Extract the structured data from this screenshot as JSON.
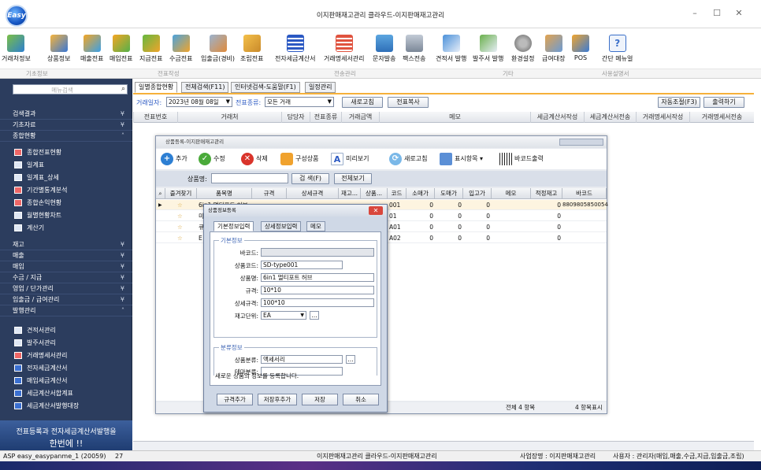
{
  "window": {
    "title": "이지판매재고관리 클라우드-이지판매재고관리",
    "logo_text": "Easy"
  },
  "ribbon": {
    "items": [
      "거래처정보",
      "상품정보",
      "매출전표",
      "매입전표",
      "지급전표",
      "수금전표",
      "입출금(경비)",
      "조립전표",
      "전자세금계산서",
      "거래명세서관리",
      "문자발송",
      "팩스전송",
      "견적서 발행",
      "발주서 발행",
      "환경설정",
      "급여대장",
      "POS",
      "간단 메뉴얼"
    ],
    "groups": [
      "기초정보",
      "전표작성",
      "전송관리",
      "기타",
      "사용설명서"
    ]
  },
  "nav": {
    "search_placeholder": "메뉴검색",
    "sections": [
      "검색결과",
      "기초자료",
      "종합현황"
    ],
    "summary_items": [
      "종합전표현황",
      "일계표",
      "일계표_상세",
      "기간별통계분석",
      "종합손익현황",
      "월별현황차트",
      "계산기"
    ],
    "mid_sections": [
      "재고",
      "매출",
      "매입",
      "수금 / 지급",
      "영업 / 단가관리",
      "입출금 / 급여관리",
      "발행관리"
    ],
    "issue_items": [
      "견적서관리",
      "발주서관리",
      "거래명세서관리",
      "전자세금계산서",
      "매입세금계산서",
      "세금계산서합계표",
      "세금계산서발행대장"
    ],
    "banner_line1": "전표등록과 전자세금계산서발행을",
    "banner_line2": "한번에 !!"
  },
  "main": {
    "tabs": [
      "일별종합현황",
      "전체검색(F11)",
      "인터넷검색-도움말(F1)",
      "일정관리"
    ],
    "date_label": "거래일자:",
    "date_value": "2023년 08월 08일",
    "type_label": "전표종류:",
    "type_value": "모든 거래",
    "refresh": "새로고침",
    "copy": "전표복사",
    "autosize": "자동조절(F3)",
    "print": "출력하기",
    "columns": [
      "전표번호",
      "거래처",
      "담당자",
      "전표종류",
      "거래금액",
      "메모",
      "세금계산서작성",
      "세금계산서전송",
      "거래명세서작성",
      "거래명세서전송"
    ]
  },
  "product_window": {
    "title": "상품등록-이지판매재고관리",
    "toolbar": [
      "추가",
      "수정",
      "삭제",
      "구성상품",
      "미리보기",
      "새로고침",
      "표시항목",
      "바코드출력"
    ],
    "search_label": "상품명:",
    "search_btn": "검 색(F)",
    "all_btn": "전체보기",
    "columns": [
      "즐겨찾기",
      "품목명",
      "규격",
      "상세규격",
      "재고...",
      "상품...",
      "코드",
      "소매가",
      "도매가",
      "입고가",
      "메모",
      "적정재고",
      "바코드"
    ],
    "rows": [
      {
        "name": "6in1 멀티포트 허브",
        "code": "001",
        "retail": "0",
        "wholesale": "0",
        "cost": "0",
        "stock": "0",
        "barcode": "8809805850054"
      },
      {
        "name": "미",
        "code": "01",
        "retail": "0",
        "wholesale": "0",
        "cost": "0",
        "stock": "0",
        "barcode": ""
      },
      {
        "name": "큐",
        "code": "A01",
        "retail": "0",
        "wholesale": "0",
        "cost": "0",
        "stock": "0",
        "barcode": ""
      },
      {
        "name": "E",
        "code": "A02",
        "retail": "0",
        "wholesale": "0",
        "cost": "0",
        "stock": "0",
        "barcode": ""
      }
    ],
    "footer_total": "전체 4 항목",
    "footer_shown": "4 항목표시"
  },
  "dialog": {
    "title": "상품정보등록",
    "tabs": [
      "기본정보입력",
      "상세정보입력",
      "메모"
    ],
    "basic_legend": "기본정보",
    "fields": {
      "barcode_label": "바코드:",
      "barcode": "",
      "code_label": "상품코드:",
      "code": "SD-type001",
      "name_label": "상품명:",
      "name": "6in1 멀티포트 허브",
      "spec_label": "규격:",
      "spec": "10*10",
      "detail_label": "상세규격:",
      "detail": "100*10",
      "unit_label": "재고단위:",
      "unit": "EA"
    },
    "class_legend": "분류정보",
    "class_label": "상품분류:",
    "class_value": "액세서리",
    "theme_label": "테마분류:",
    "theme_value": "",
    "notice": "새로운 상품의 정보를 등록합니다.",
    "buttons": [
      "규격추가",
      "저장후추가",
      "저장",
      "취소"
    ]
  },
  "status": {
    "left": "ASP easy_easypanme_1 (20059)",
    "count": "27",
    "center": "이지판매재고관리 클라우드-이지판매재고관리",
    "company": "사업장명 : 이지판매재고관리",
    "user": "사용자 : 관리자(매입,매출,수금,지급,입출금,조립)"
  },
  "colors": {
    "nav_bg": "#2c3d5e",
    "accent_orange": "#f6b13a",
    "link_blue": "#2b59c3"
  }
}
